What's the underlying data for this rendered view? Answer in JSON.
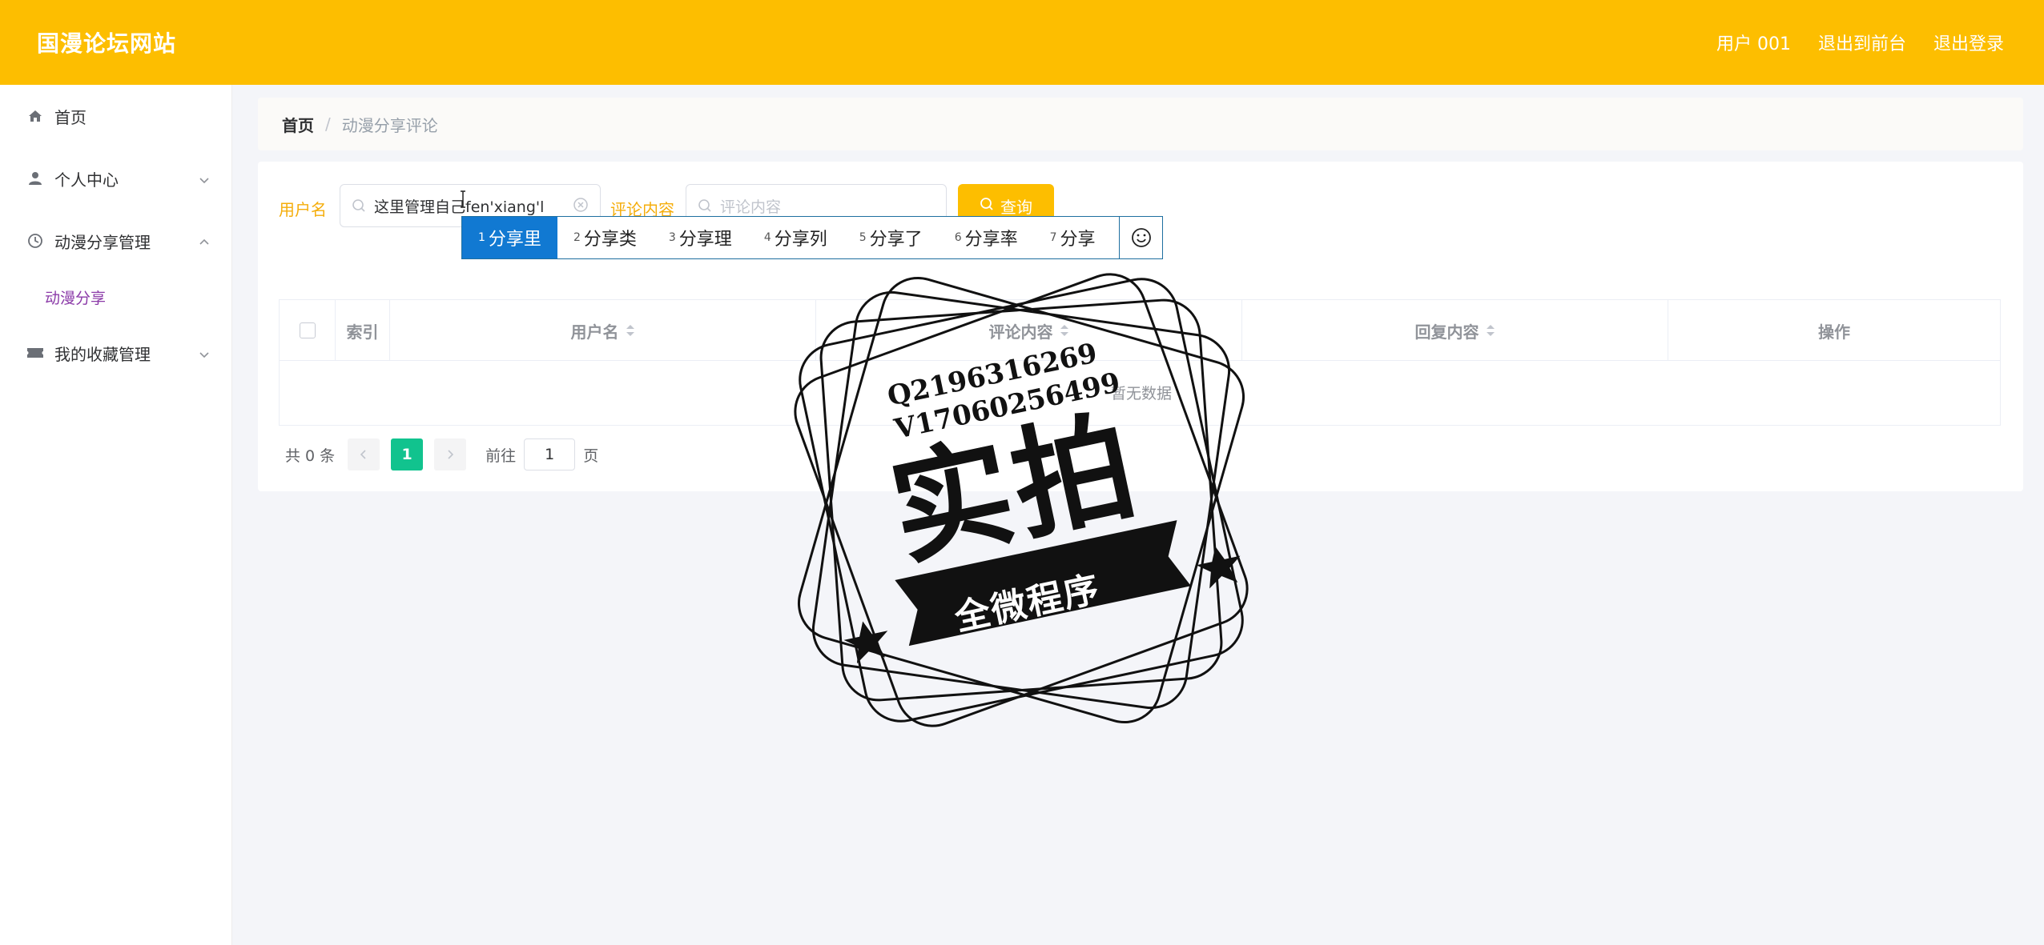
{
  "header": {
    "brand": "国漫论坛网站",
    "user": "用户 001",
    "to_front": "退出到前台",
    "logout": "退出登录"
  },
  "sidebar": {
    "items": [
      {
        "label": "首页",
        "icon": "home-icon"
      },
      {
        "label": "个人中心",
        "icon": "user-icon"
      },
      {
        "label": "动漫分享管理",
        "icon": "clock-icon"
      },
      {
        "label": "动漫分享",
        "icon": ""
      },
      {
        "label": "我的收藏管理",
        "icon": "ticket-icon"
      }
    ]
  },
  "breadcrumb": {
    "home": "首页",
    "separator": "/",
    "current": "动漫分享评论"
  },
  "filters": {
    "username_label": "用户名",
    "username_value": "这里管理自己fen'xiang'l",
    "comment_label": "评论内容",
    "comment_placeholder": "评论内容",
    "search_button": "查询"
  },
  "ime": {
    "candidates": [
      {
        "num": "1",
        "text": "分享里"
      },
      {
        "num": "2",
        "text": "分享类"
      },
      {
        "num": "3",
        "text": "分享理"
      },
      {
        "num": "4",
        "text": "分享列"
      },
      {
        "num": "5",
        "text": "分享了"
      },
      {
        "num": "6",
        "text": "分享率"
      },
      {
        "num": "7",
        "text": "分享"
      }
    ]
  },
  "table": {
    "columns": [
      "索引",
      "用户名",
      "评论内容",
      "回复内容",
      "操作"
    ],
    "empty_text": "暂无数据"
  },
  "pagination": {
    "total": "共 0 条",
    "current_page": "1",
    "goto_label": "前往",
    "goto_value": "1",
    "page_suffix": "页"
  },
  "watermark": {
    "line1": "Q2196316269",
    "line2": "V17060256499",
    "big": "实拍",
    "banner": "全微程序"
  },
  "colors": {
    "accent": "#fdbe00",
    "label": "#f5ad0a",
    "submenu_active": "#8b3aa8",
    "page_active": "#11c38e",
    "ime_active": "#1179d2"
  }
}
